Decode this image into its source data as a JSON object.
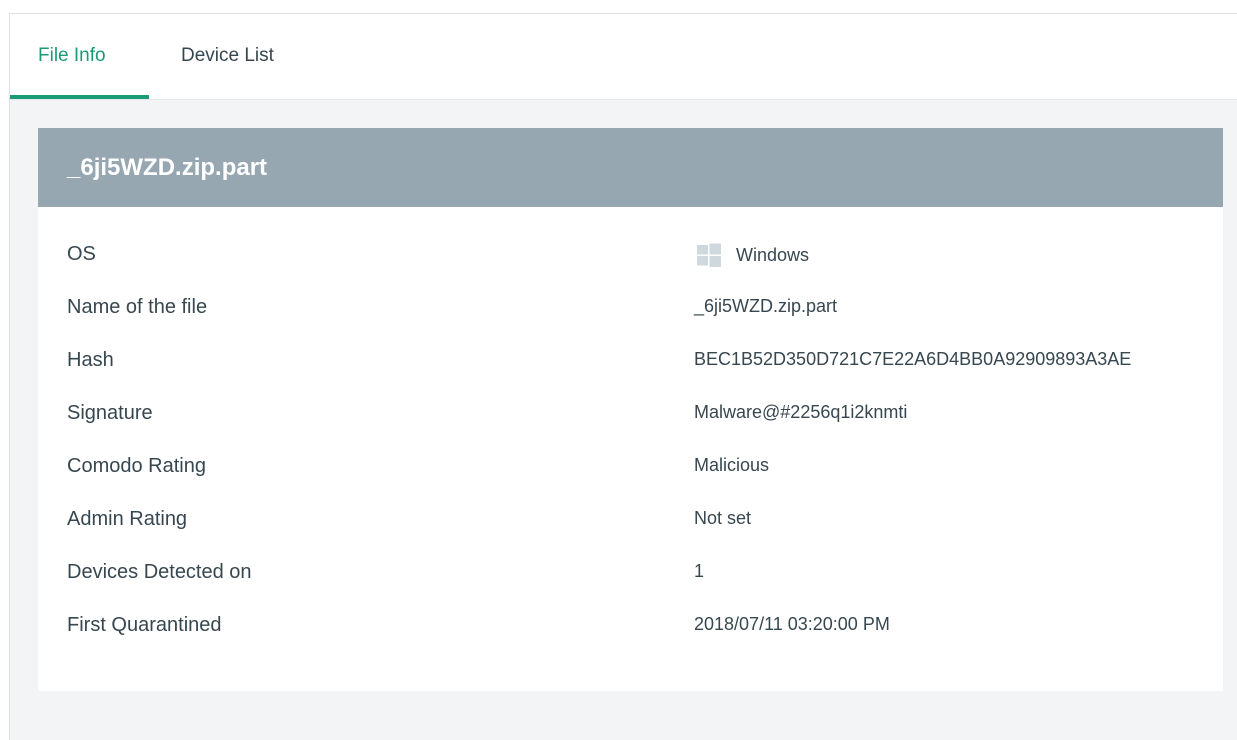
{
  "tabs": [
    {
      "label": "File Info",
      "active": true
    },
    {
      "label": "Device List",
      "active": false
    }
  ],
  "file": {
    "title": "_6ji5WZD.zip.part",
    "details": [
      {
        "label": "OS",
        "value": "Windows",
        "icon": "windows-icon"
      },
      {
        "label": "Name of the file",
        "value": "_6ji5WZD.zip.part"
      },
      {
        "label": "Hash",
        "value": "BEC1B52D350D721C7E22A6D4BB0A92909893A3AE"
      },
      {
        "label": "Signature",
        "value": "Malware@#2256q1i2knmti"
      },
      {
        "label": "Comodo Rating",
        "value": "Malicious"
      },
      {
        "label": "Admin Rating",
        "value": "Not set"
      },
      {
        "label": "Devices Detected on",
        "value": "1"
      },
      {
        "label": "First Quarantined",
        "value": "2018/07/11 03:20:00 PM"
      }
    ]
  },
  "colors": {
    "accent": "#1a9a75",
    "header_bg": "#97a7b2",
    "text": "#37474f"
  }
}
